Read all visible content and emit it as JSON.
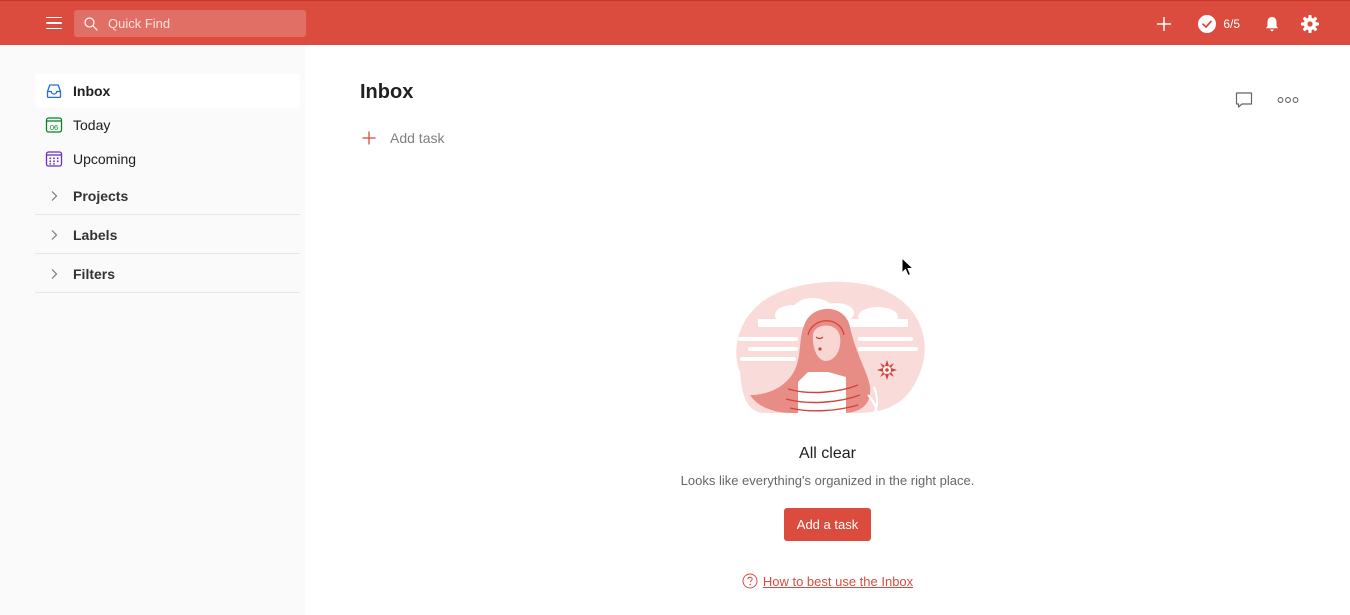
{
  "topbar": {
    "search_placeholder": "Quick Find",
    "karma_count": "6/5"
  },
  "sidebar": {
    "items": [
      {
        "label": "Inbox",
        "icon": "inbox-icon",
        "active": true
      },
      {
        "label": "Today",
        "icon": "today-icon",
        "day": "06"
      },
      {
        "label": "Upcoming",
        "icon": "calendar-icon"
      }
    ],
    "sections": [
      {
        "label": "Projects"
      },
      {
        "label": "Labels"
      },
      {
        "label": "Filters"
      }
    ]
  },
  "main": {
    "title": "Inbox",
    "add_task_label": "Add task",
    "empty_state": {
      "title": "All clear",
      "subtitle": "Looks like everything's organized in the right place.",
      "button_label": "Add a task",
      "help_link": "How to best use the Inbox"
    }
  },
  "colors": {
    "brand": "#db4c3f",
    "inbox_icon": "#246fe0",
    "today_icon": "#058527",
    "upcoming_icon": "#692fc2"
  }
}
